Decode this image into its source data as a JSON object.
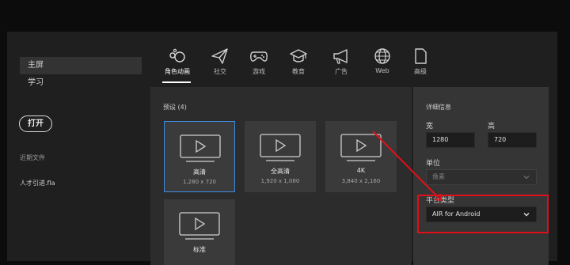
{
  "sidebar": {
    "items": [
      {
        "label": "主屏",
        "active": true
      },
      {
        "label": "学习",
        "active": false
      }
    ],
    "open_label": "打开",
    "recent_title": "近期文件",
    "recent_files": [
      "人才引进.fla"
    ]
  },
  "categories": [
    {
      "label": "角色动画",
      "icon": "character-animation-icon",
      "active": true
    },
    {
      "label": "社交",
      "icon": "paper-plane-icon",
      "active": false
    },
    {
      "label": "游戏",
      "icon": "gamepad-icon",
      "active": false
    },
    {
      "label": "教育",
      "icon": "graduation-cap-icon",
      "active": false
    },
    {
      "label": "广告",
      "icon": "megaphone-icon",
      "active": false
    },
    {
      "label": "Web",
      "icon": "globe-icon",
      "active": false
    },
    {
      "label": "高级",
      "icon": "document-icon",
      "active": false
    }
  ],
  "presets": {
    "title": "预设 (4)",
    "cards": [
      {
        "name": "高清",
        "resolution": "1,280 x 720",
        "selected": true
      },
      {
        "name": "全高清",
        "resolution": "1,920 x 1,080",
        "selected": false
      },
      {
        "name": "4K",
        "resolution": "3,840 x 2,160",
        "selected": false
      },
      {
        "name": "标准",
        "resolution": "",
        "selected": false
      }
    ]
  },
  "details": {
    "title": "详细信息",
    "width_label": "宽",
    "width_value": "1280",
    "height_label": "高",
    "height_value": "720",
    "unit_label": "单位",
    "unit_value": "像素",
    "platform_label": "平台类型",
    "platform_value": "AIR for Android"
  },
  "colors": {
    "accent_selection": "#3d8ee0",
    "annotation_red": "#e0101a"
  }
}
